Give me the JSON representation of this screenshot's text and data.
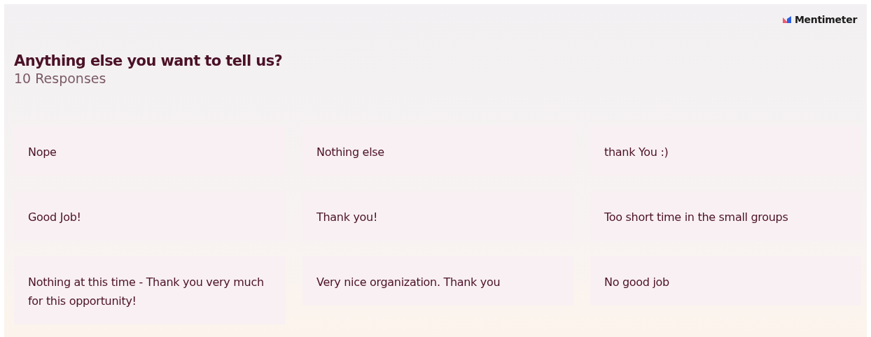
{
  "brand": {
    "name": "Mentimeter"
  },
  "question": {
    "title": "Anything else you want to tell us?",
    "count": "10 Responses"
  },
  "responses": [
    {
      "text": "Nope"
    },
    {
      "text": "Nothing else"
    },
    {
      "text": "thank You :)"
    },
    {
      "text": "Good Job!"
    },
    {
      "text": "Thank you!"
    },
    {
      "text": "Too short time in the small groups"
    },
    {
      "text": "Nothing at this time - Thank you very much for this opportunity!"
    },
    {
      "text": "Very nice organization. Thank you"
    },
    {
      "text": "No good job"
    }
  ]
}
